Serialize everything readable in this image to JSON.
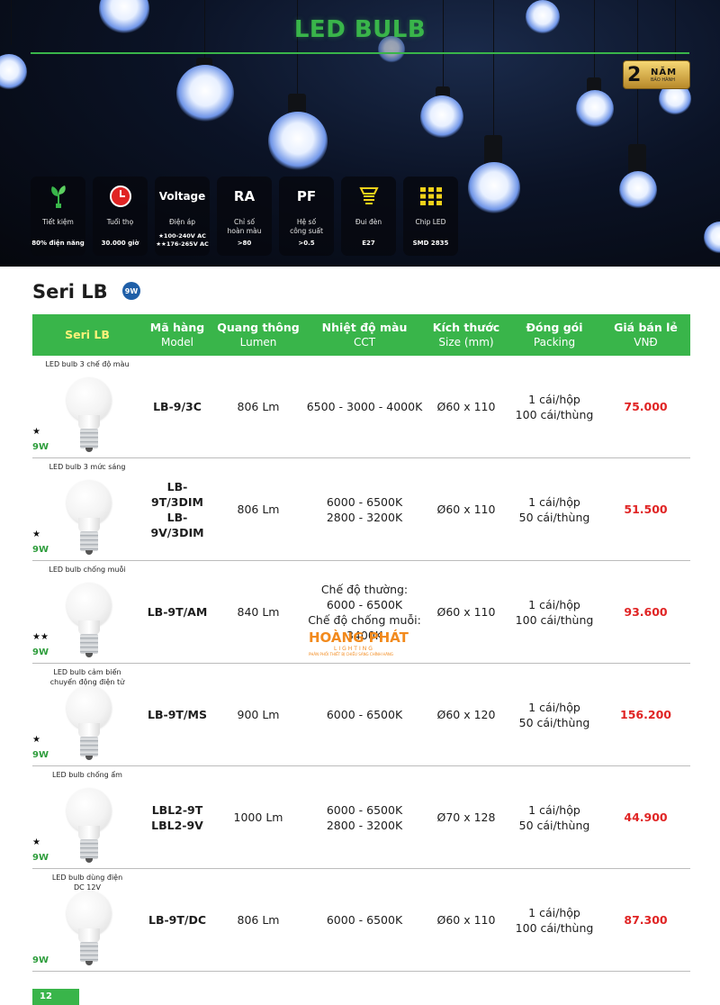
{
  "hero": {
    "title": "LED BULB",
    "warranty": {
      "number": "2",
      "text": "NĂM",
      "sub": "BẢO HÀNH"
    },
    "features": [
      {
        "icon": "leaf-plug-icon",
        "label": "Tiết kiệm",
        "value": "80% điện năng"
      },
      {
        "icon": "clock-icon",
        "label": "Tuổi thọ",
        "value": "30.000 giờ"
      },
      {
        "icon": "voltage-icon",
        "icon_text": "Voltage",
        "label": "Điện áp",
        "value": "★100-240V AC\n★★176-265V AC"
      },
      {
        "icon": "ra-icon",
        "icon_text": "RA",
        "label": "Chỉ số\nhoàn màu",
        "value": ">80"
      },
      {
        "icon": "pf-icon",
        "icon_text": "PF",
        "label": "Hệ số\ncông suất",
        "value": ">0.5"
      },
      {
        "icon": "socket-icon",
        "label": "Đui đèn",
        "value": "E27"
      },
      {
        "icon": "chip-icon",
        "label": "Chip LED",
        "value": "SMD 2835"
      }
    ]
  },
  "series": {
    "title": "Seri LB",
    "badge": "9W"
  },
  "table": {
    "headers": [
      {
        "title": "Seri LB",
        "sub": ""
      },
      {
        "title": "Mã hàng",
        "sub": "Model"
      },
      {
        "title": "Quang thông",
        "sub": "Lumen"
      },
      {
        "title": "Nhiệt độ màu",
        "sub": "CCT"
      },
      {
        "title": "Kích thước",
        "sub": "Size (mm)"
      },
      {
        "title": "Đóng gói",
        "sub": "Packing"
      },
      {
        "title": "Giá bán lẻ",
        "sub": "VNĐ"
      }
    ],
    "rows": [
      {
        "name": "LED bulb 3 chế độ màu",
        "stars": "★",
        "watt": "9W",
        "model": "LB-9/3C",
        "lumen": "806 Lm",
        "cct": "6500 - 3000 - 4000K",
        "size": "Ø60 x 110",
        "packing": "1 cái/hộp\n100 cái/thùng",
        "price": "75.000"
      },
      {
        "name": "LED bulb 3 mức sáng",
        "stars": "★",
        "watt": "9W",
        "model": "LB-9T/3DIM\nLB-9V/3DIM",
        "lumen": "806 Lm",
        "cct": "6000 - 6500K\n2800 - 3200K",
        "size": "Ø60 x 110",
        "packing": "1 cái/hộp\n50 cái/thùng",
        "price": "51.500"
      },
      {
        "name": "LED bulb chống muỗi",
        "stars": "★★",
        "watt": "9W",
        "model": "LB-9T/AM",
        "lumen": "840 Lm",
        "cct": "Chế độ thường:\n6000 - 6500K\nChế độ chống muỗi:\n3400K",
        "size": "Ø60 x 110",
        "packing": "1 cái/hộp\n100 cái/thùng",
        "price": "93.600"
      },
      {
        "name": "LED bulb cảm biến\nchuyển động điện tử",
        "stars": "★",
        "watt": "9W",
        "model": "LB-9T/MS",
        "lumen": "900 Lm",
        "cct": "6000 - 6500K",
        "size": "Ø60 x 120",
        "packing": "1 cái/hộp\n50 cái/thùng",
        "price": "156.200"
      },
      {
        "name": "LED bulb chống ẩm",
        "stars": "★",
        "watt": "9W",
        "model": "LBL2-9T\nLBL2-9V",
        "lumen": "1000 Lm",
        "cct": "6000 - 6500K\n2800 - 3200K",
        "size": "Ø70 x 128",
        "packing": "1 cái/hộp\n50 cái/thùng",
        "price": "44.900"
      },
      {
        "name": "LED bulb dùng điện\nDC 12V",
        "stars": "",
        "watt": "9W",
        "model": "LB-9T/DC",
        "lumen": "806 Lm",
        "cct": "6000 - 6500K",
        "size": "Ø60 x 110",
        "packing": "1 cái/hộp\n100 cái/thùng",
        "price": "87.300"
      }
    ]
  },
  "watermark": {
    "brand": "HOÀNG PHÁT",
    "sub": "LIGHTING",
    "tag": "PHÂN PHỐI THIẾT BỊ CHIẾU SÁNG CHÍNH HÃNG"
  },
  "page_number": "12",
  "colors": {
    "accent_green": "#39b54a",
    "price_red": "#e02424",
    "header_yellow": "#fff27a"
  }
}
